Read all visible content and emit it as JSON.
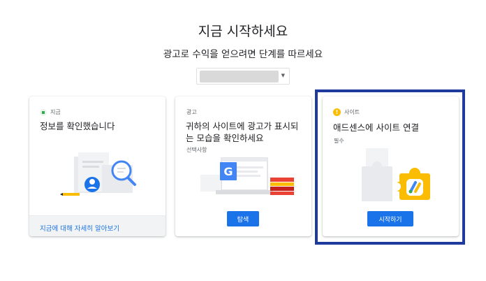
{
  "header": {
    "title": "지금 시작하세요",
    "subtitle": "광고로 수익을 얻으려면 단계를 따르세요"
  },
  "site_selector": {
    "value": ""
  },
  "cards": [
    {
      "tag": "지금",
      "title": "정보를 확인했습니다",
      "footer_link": "지금에 대해 자세히 알아보기"
    },
    {
      "tag": "광고",
      "title": "귀하의 사이트에 광고가 표시되는 모습을 확인하세요",
      "note": "선택사항",
      "button": "탐색"
    },
    {
      "tag": "사이트",
      "tag_icon": "!",
      "title": "애드센스에 사이트 연결",
      "note": "필수",
      "button": "시작하기"
    }
  ],
  "colors": {
    "primary_blue": "#1a73e8",
    "highlight_border": "#1e3a9c",
    "green_status": "#34a853",
    "yellow_status": "#fbbc04"
  }
}
